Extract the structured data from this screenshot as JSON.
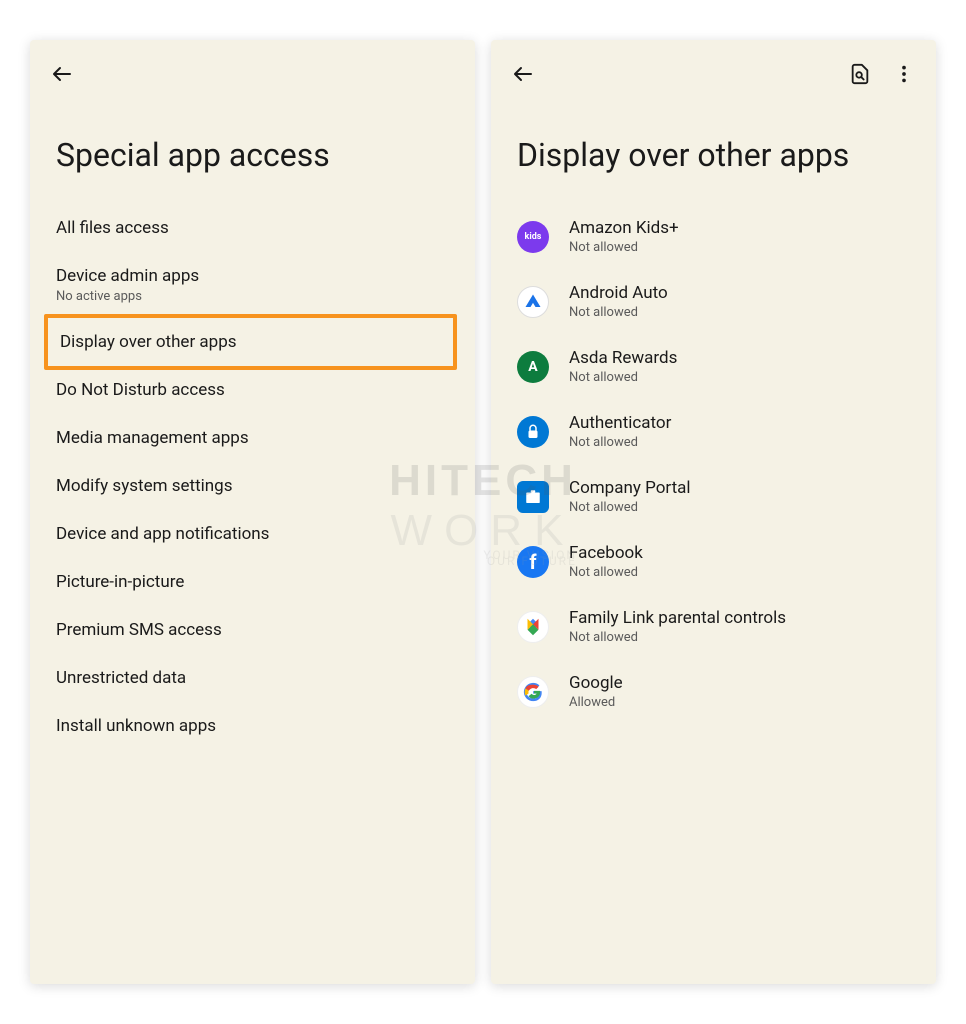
{
  "left_screen": {
    "title": "Special app access",
    "items": [
      {
        "label": "All files access",
        "sublabel": null,
        "highlighted": false
      },
      {
        "label": "Device admin apps",
        "sublabel": "No active apps",
        "highlighted": false
      },
      {
        "label": "Display over other apps",
        "sublabel": null,
        "highlighted": true
      },
      {
        "label": "Do Not Disturb access",
        "sublabel": null,
        "highlighted": false
      },
      {
        "label": "Media management apps",
        "sublabel": null,
        "highlighted": false
      },
      {
        "label": "Modify system settings",
        "sublabel": null,
        "highlighted": false
      },
      {
        "label": "Device and app notifications",
        "sublabel": null,
        "highlighted": false
      },
      {
        "label": "Picture-in-picture",
        "sublabel": null,
        "highlighted": false
      },
      {
        "label": "Premium SMS access",
        "sublabel": null,
        "highlighted": false
      },
      {
        "label": "Unrestricted data",
        "sublabel": null,
        "highlighted": false
      },
      {
        "label": "Install unknown apps",
        "sublabel": null,
        "highlighted": false
      }
    ]
  },
  "right_screen": {
    "title": "Display over other apps",
    "apps": [
      {
        "name": "Amazon Kids+",
        "status": "Not allowed",
        "icon_type": "amazon",
        "icon_text": "kids"
      },
      {
        "name": "Android Auto",
        "status": "Not allowed",
        "icon_type": "android-auto",
        "icon_text": ""
      },
      {
        "name": "Asda Rewards",
        "status": "Not allowed",
        "icon_type": "asda",
        "icon_text": "A"
      },
      {
        "name": "Authenticator",
        "status": "Not allowed",
        "icon_type": "authenticator",
        "icon_text": ""
      },
      {
        "name": "Company Portal",
        "status": "Not allowed",
        "icon_type": "company",
        "icon_text": ""
      },
      {
        "name": "Facebook",
        "status": "Not allowed",
        "icon_type": "facebook",
        "icon_text": "f"
      },
      {
        "name": "Family Link parental controls",
        "status": "Not allowed",
        "icon_type": "family",
        "icon_text": ""
      },
      {
        "name": "Google",
        "status": "Allowed",
        "icon_type": "google",
        "icon_text": "G"
      }
    ]
  },
  "watermark": {
    "line1": "HITECH",
    "line2": "WORK",
    "tag1": "YOUR VISION",
    "tag2": "OUR FUTURE"
  }
}
